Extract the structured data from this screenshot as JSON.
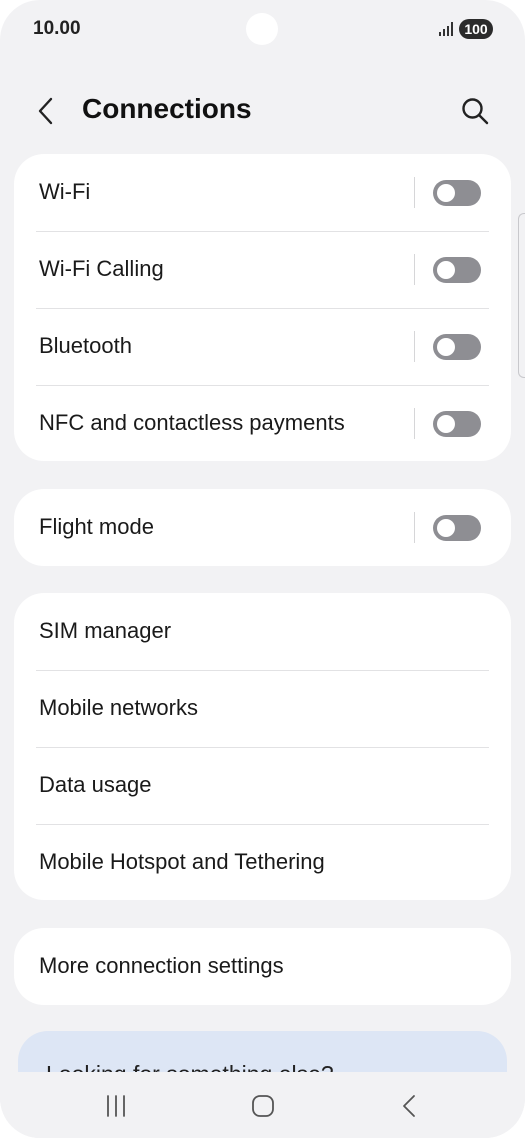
{
  "status_bar": {
    "time": "10.00",
    "battery": "100",
    "icons": [
      "signal-icon"
    ]
  },
  "header": {
    "title": "Connections",
    "icons": [
      "back-icon",
      "search-icon"
    ]
  },
  "groups": {
    "wireless": [
      {
        "label": "Wi-Fi",
        "toggle": true,
        "on": false
      },
      {
        "label": "Wi-Fi Calling",
        "toggle": true,
        "on": false
      },
      {
        "label": "Bluetooth",
        "toggle": true,
        "on": false
      },
      {
        "label": "NFC and contactless payments",
        "toggle": true,
        "on": false
      }
    ],
    "flight": [
      {
        "label": "Flight mode",
        "toggle": true,
        "on": false
      }
    ],
    "network": [
      {
        "label": "SIM manager"
      },
      {
        "label": "Mobile networks"
      },
      {
        "label": "Data usage"
      },
      {
        "label": "Mobile Hotspot and Tethering"
      }
    ],
    "more": [
      {
        "label": "More connection settings"
      }
    ]
  },
  "suggestion": {
    "text": "Looking for something else?"
  },
  "nav_bar": {
    "icons": [
      "recents-icon",
      "home-icon",
      "back-icon"
    ]
  },
  "colors": {
    "background": "#f2f2f4",
    "card": "#ffffff",
    "toggle_off": "#8e8e93",
    "suggestion_card": "#dde6f5",
    "text": "#1a1a1a"
  }
}
